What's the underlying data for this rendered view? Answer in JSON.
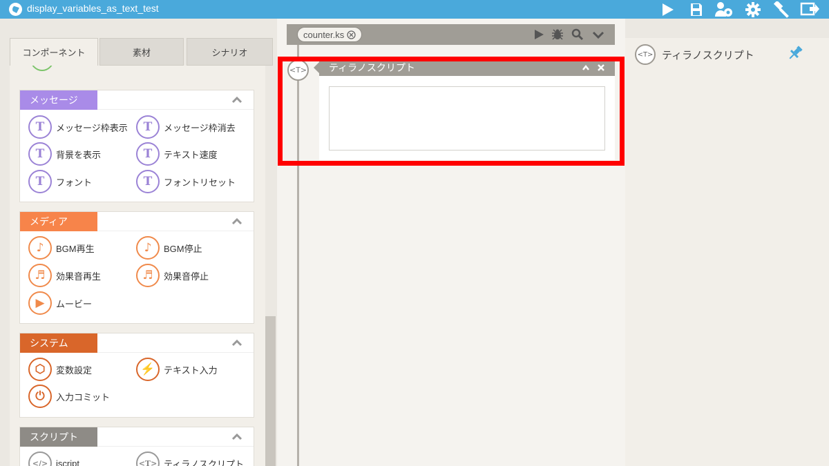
{
  "app": {
    "title": "display_variables_as_text_test",
    "toolbar": [
      "play-icon",
      "save-icon",
      "users-settings-icon",
      "gear-icon",
      "hammer-icon",
      "export-icon"
    ]
  },
  "left": {
    "tabs": [
      {
        "label": "コンポーネント",
        "active": true
      },
      {
        "label": "素材",
        "active": false
      },
      {
        "label": "シナリオ",
        "active": false
      }
    ],
    "sections": {
      "message": {
        "title": "メッセージ",
        "color": "#a98be8",
        "items": [
          {
            "label": "メッセージ枠表示",
            "icon": "message-window-show-icon",
            "glyph": "T"
          },
          {
            "label": "メッセージ枠消去",
            "icon": "message-window-hide-icon",
            "glyph": "T"
          },
          {
            "label": "背景を表示",
            "icon": "show-background-icon",
            "glyph": "T"
          },
          {
            "label": "テキスト速度",
            "icon": "text-speed-icon",
            "glyph": "T"
          },
          {
            "label": "フォント",
            "icon": "font-icon",
            "glyph": "T"
          },
          {
            "label": "フォントリセット",
            "icon": "font-reset-icon",
            "glyph": "T"
          }
        ]
      },
      "media": {
        "title": "メディア",
        "color": "#f7844a",
        "items": [
          {
            "label": "BGM再生",
            "icon": "bgm-play-icon",
            "glyph": "♪"
          },
          {
            "label": "BGM停止",
            "icon": "bgm-stop-icon",
            "glyph": "♪"
          },
          {
            "label": "効果音再生",
            "icon": "se-play-icon",
            "glyph": "♬"
          },
          {
            "label": "効果音停止",
            "icon": "se-stop-icon",
            "glyph": "♬"
          },
          {
            "label": "ムービー",
            "icon": "movie-icon",
            "glyph": "▶"
          }
        ]
      },
      "system": {
        "title": "システム",
        "color": "#d9662a",
        "items": [
          {
            "label": "変数設定",
            "icon": "variable-settings-icon",
            "glyph": "⬡"
          },
          {
            "label": "テキスト入力",
            "icon": "text-input-icon",
            "glyph": "⚡"
          },
          {
            "label": "入力コミット",
            "icon": "input-commit-icon",
            "glyph": "⏻"
          }
        ]
      },
      "script": {
        "title": "スクリプト",
        "color": "#8e8b86",
        "items": [
          {
            "label": "iscript",
            "icon": "iscript-icon",
            "glyph": "</>"
          },
          {
            "label": "ティラノスクリプト",
            "icon": "tyrano-script-icon",
            "glyph": "<T>"
          }
        ]
      }
    }
  },
  "editor": {
    "file_tab": "counter.ks",
    "card": {
      "title": "ティラノスクリプト",
      "node_glyph": "<T>",
      "text": ""
    }
  },
  "right": {
    "node_glyph": "<T>",
    "title": "ティラノスクリプト"
  }
}
